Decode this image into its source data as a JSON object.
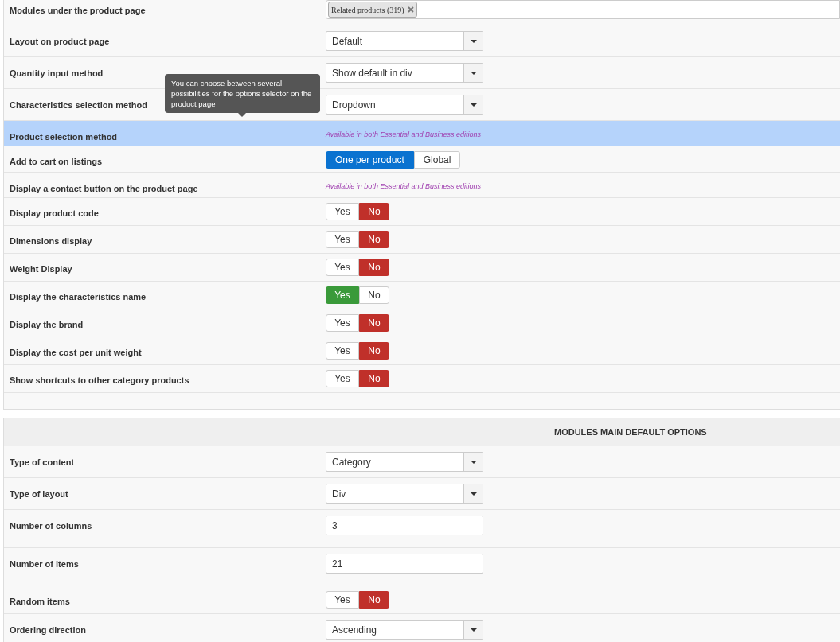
{
  "sections": [
    {
      "rows": [
        {
          "kind": "tags",
          "label": "Modules under the product page",
          "tags": [
            "Related products (319)"
          ]
        },
        {
          "kind": "select",
          "label": "Layout on product page",
          "value": "Default"
        },
        {
          "kind": "select",
          "label": "Quantity input method",
          "value": "Show default in div"
        },
        {
          "kind": "select",
          "label": "Characteristics selection method",
          "value": "Dropdown",
          "tooltip": "You can choose between several possibilities for the options selector on the product page"
        },
        {
          "kind": "note",
          "label": "Product selection method",
          "note": "Available in both Essential and Business editions",
          "highlighted": true
        },
        {
          "kind": "segmented",
          "label": "Add to cart on listings",
          "options": [
            {
              "label": "One per product",
              "selected": true
            },
            {
              "label": "Global",
              "selected": false
            }
          ]
        },
        {
          "kind": "note",
          "label": "Display a contact button on the product page",
          "note": "Available in both Essential and Business editions",
          "highlighted": false
        },
        {
          "kind": "yesno",
          "label": "Display product code",
          "yes": "Yes",
          "no": "No",
          "on": false
        },
        {
          "kind": "yesno",
          "label": "Dimensions display",
          "yes": "Yes",
          "no": "No",
          "on": false
        },
        {
          "kind": "yesno",
          "label": "Weight Display",
          "yes": "Yes",
          "no": "No",
          "on": false
        },
        {
          "kind": "yesno",
          "label": "Display the characteristics name",
          "yes": "Yes",
          "no": "No",
          "on": true
        },
        {
          "kind": "yesno",
          "label": "Display the brand",
          "yes": "Yes",
          "no": "No",
          "on": false
        },
        {
          "kind": "yesno",
          "label": "Display the cost per unit weight",
          "yes": "Yes",
          "no": "No",
          "on": false
        },
        {
          "kind": "yesno",
          "label": "Show shortcuts to other category products",
          "yes": "Yes",
          "no": "No",
          "on": false
        }
      ]
    },
    {
      "header": "MODULES MAIN DEFAULT OPTIONS",
      "rows": [
        {
          "kind": "select",
          "label": "Type of content",
          "value": "Category"
        },
        {
          "kind": "select",
          "label": "Type of layout",
          "value": "Div"
        },
        {
          "kind": "input",
          "label": "Number of columns",
          "value": "3"
        },
        {
          "kind": "input",
          "label": "Number of items",
          "value": "21"
        },
        {
          "kind": "yesno",
          "label": "Random items",
          "yes": "Yes",
          "no": "No",
          "on": false
        },
        {
          "kind": "select",
          "label": "Ordering direction",
          "value": "Ascending"
        }
      ]
    }
  ]
}
